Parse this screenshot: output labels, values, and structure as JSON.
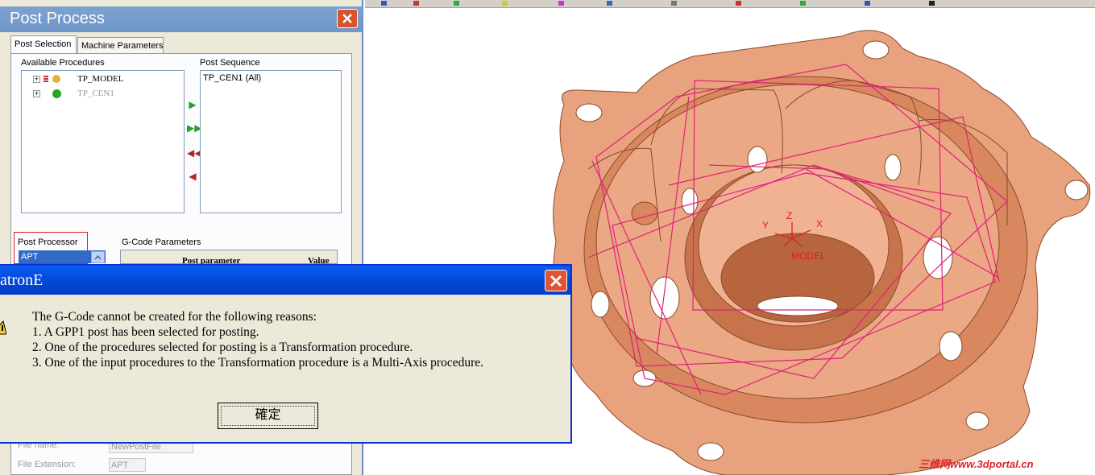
{
  "panel": {
    "title": "Post Process",
    "tabs": [
      {
        "label": "Post Selection"
      },
      {
        "label": "Machine Parameters"
      }
    ],
    "available_label": "Available Procedures",
    "sequence_label": "Post Sequence",
    "procedures": [
      {
        "label": "TP_MODEL"
      },
      {
        "label": "TP_CEN1"
      }
    ],
    "sequence_items": [
      {
        "label": "TP_CEN1 (All)"
      }
    ],
    "post_processor_label": "Post Processor",
    "post_processor_value": "APT",
    "gcode_label": "G-Code Parameters",
    "grid_col1": "Post parameter",
    "grid_col2": "Value",
    "file_name_label": "File name:",
    "file_name_value": "NewPostFile",
    "file_ext_label": "File Extension:",
    "file_ext_value": "APT"
  },
  "dialog": {
    "title": "atronE",
    "lines": [
      "The G-Code cannot be created for the following reasons:",
      "1. A GPP1 post has been selected for posting.",
      "2. One of the procedures selected for posting is a Transformation procedure.",
      "3. One of the input procedures to the Transformation procedure is a Multi-Axis procedure."
    ],
    "ok_label": "確定"
  },
  "viewport": {
    "axis_y": "Y",
    "axis_z": "Z",
    "axis_x": "X",
    "model_label": "MODEL",
    "watermark": "三维网www.3dportal.cn"
  },
  "colors": {
    "part": "#e8a27e",
    "toolpath": "#e0207a",
    "axis": "#e02020"
  }
}
